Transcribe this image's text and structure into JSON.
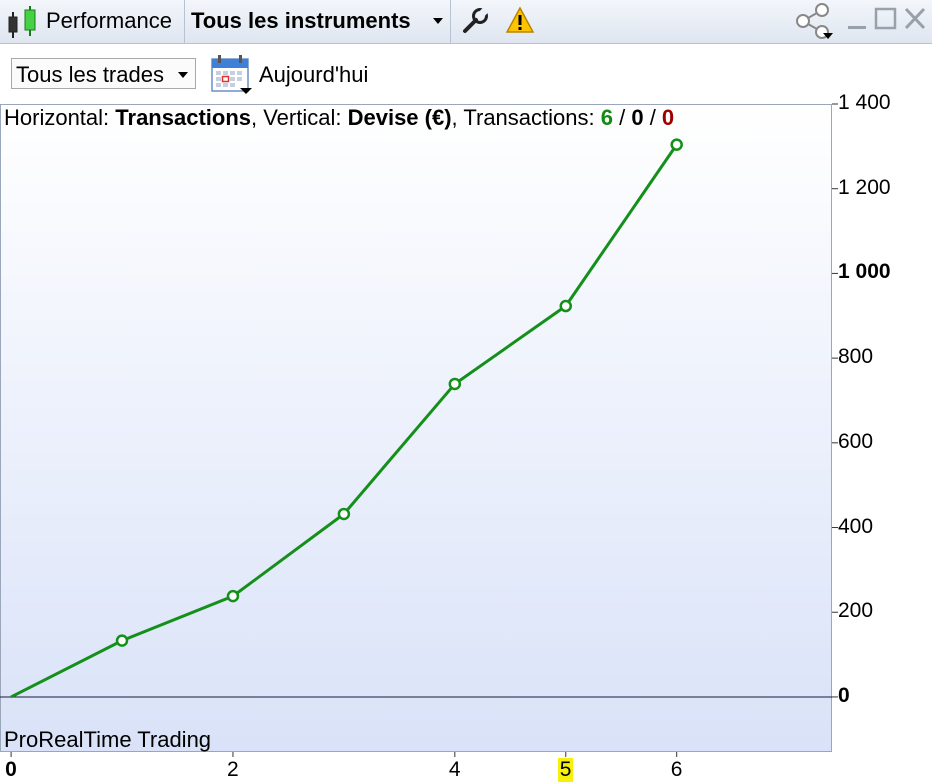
{
  "titlebar": {
    "app_label": "Performance",
    "instruments_label": "Tous les instruments"
  },
  "toolbar": {
    "trades_filter": "Tous les trades",
    "date_label": "Aujourd'hui"
  },
  "header": {
    "h_prefix": "Horizontal: ",
    "h_value": "Transactions",
    "v_prefix": ", Vertical: ",
    "v_value": "Devise (€)",
    "t_prefix": ", Transactions: ",
    "count_win": "6",
    "count_even": "0",
    "count_loss": "0",
    "slash": " / ",
    "colors": {
      "win": "#138a13",
      "loss": "#a10000"
    }
  },
  "watermark": "ProRealTime Trading",
  "chart_data": {
    "type": "line",
    "x": [
      0,
      1,
      2,
      3,
      4,
      5,
      6
    ],
    "y": [
      0,
      133,
      238,
      432,
      739,
      923,
      1304
    ],
    "series_color": "#14901a",
    "ylim": [
      -130,
      1400
    ],
    "xlim": [
      -0.1,
      7.4
    ],
    "y_ticks": [
      {
        "value": 1400,
        "label": "1 400",
        "bold": false
      },
      {
        "value": 1200,
        "label": "1 200",
        "bold": false
      },
      {
        "value": 1000,
        "label": "1 000",
        "bold": true
      },
      {
        "value": 800,
        "label": "800",
        "bold": false
      },
      {
        "value": 600,
        "label": "600",
        "bold": false
      },
      {
        "value": 400,
        "label": "400",
        "bold": false
      },
      {
        "value": 200,
        "label": "200",
        "bold": false
      },
      {
        "value": 0,
        "label": "0",
        "bold": true
      }
    ],
    "x_ticks": [
      {
        "value": 0,
        "label": "0",
        "bold": true,
        "highlight": false
      },
      {
        "value": 2,
        "label": "2",
        "bold": false,
        "highlight": false
      },
      {
        "value": 4,
        "label": "4",
        "bold": false,
        "highlight": false
      },
      {
        "value": 5,
        "label": "5",
        "bold": false,
        "highlight": true
      },
      {
        "value": 6,
        "label": "6",
        "bold": false,
        "highlight": false
      }
    ]
  }
}
